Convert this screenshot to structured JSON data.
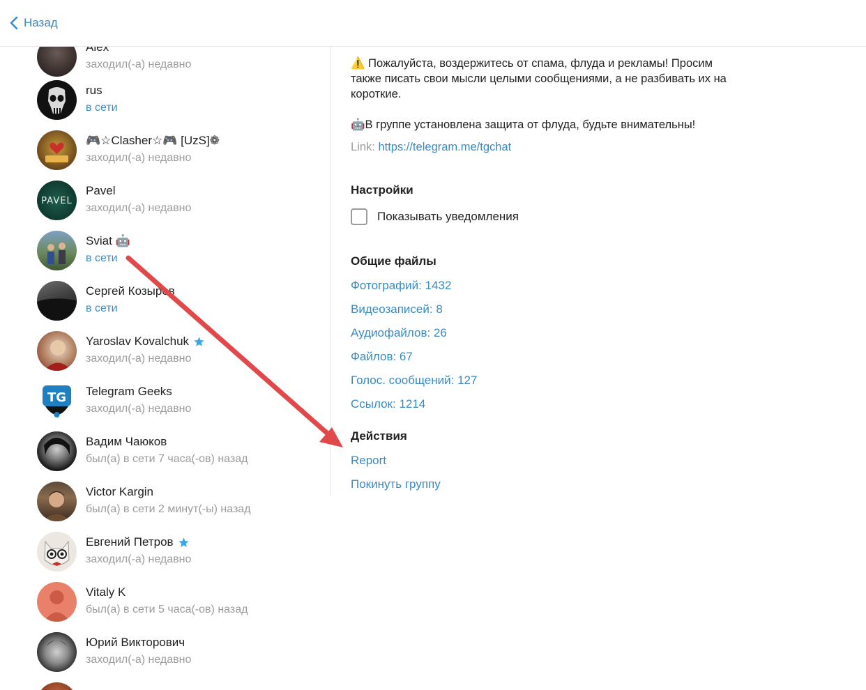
{
  "header": {
    "back_label": "Назад"
  },
  "members": [
    {
      "name": "Alex",
      "status": "заходил(-а) недавно",
      "online": false
    },
    {
      "name": "rus",
      "status": "в сети",
      "online": true
    },
    {
      "name": "🎮☆Clasher☆🎮 [UzS]❁",
      "status": "заходил(-а) недавно",
      "online": false
    },
    {
      "name": "Pavel",
      "status": "заходил(-а) недавно",
      "online": false
    },
    {
      "name": "Sviat 🤖",
      "status": "в сети",
      "online": true
    },
    {
      "name": "Сергей Козырев",
      "status": "в сети",
      "online": true
    },
    {
      "name": "Yaroslav Kovalchuk",
      "status": "заходил(-а) недавно",
      "online": false,
      "star": true
    },
    {
      "name": "Telegram Geeks",
      "status": "заходил(-а) недавно",
      "online": false
    },
    {
      "name": "Вадим Чаюков",
      "status": "был(а) в сети 7 часа(-ов) назад",
      "online": false
    },
    {
      "name": "Victor Kargin",
      "status": "был(а) в сети 2 минут(-ы) назад",
      "online": false
    },
    {
      "name": "Евгений Петров",
      "status": "заходил(-а) недавно",
      "online": false,
      "star": true
    },
    {
      "name": "Vitaly K",
      "status": "был(а) в сети 5 часа(-ов) назад",
      "online": false
    },
    {
      "name": "Юрий Викторович",
      "status": "заходил(-а) недавно",
      "online": false
    }
  ],
  "info": {
    "description_1": "⚠️ Пожалуйста, воздержитесь от спама, флуда и рекламы! Просим также писать свои мысли целыми сообщениями, а не разбивать их на короткие.",
    "description_2": "🤖В группе установлена защита от флуда, будьте внимательны!",
    "link_label": "Link:",
    "link_url": "https://telegram.me/tgchat"
  },
  "settings": {
    "title": "Настройки",
    "notifications_label": "Показывать уведомления"
  },
  "files": {
    "title": "Общие файлы",
    "items": [
      "Фотографий: 1432",
      "Видеозаписей: 8",
      "Аудиофайлов: 26",
      "Файлов: 67",
      "Голос. сообщений: 127",
      "Ссылок: 1214"
    ]
  },
  "actions": {
    "title": "Действия",
    "report_label": "Report",
    "leave_label": "Покинуть группу"
  },
  "colors": {
    "link": "#3a8ac4",
    "annotation_arrow": "#e0484a",
    "verified_star": "#3ea6e0"
  }
}
